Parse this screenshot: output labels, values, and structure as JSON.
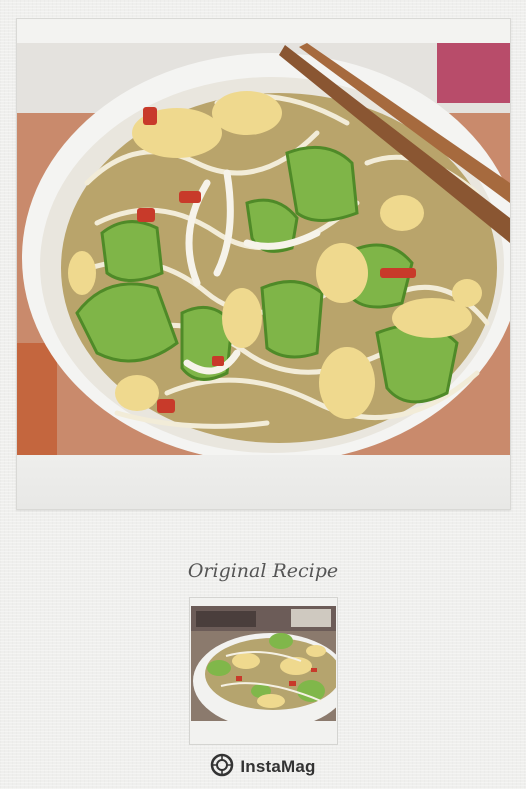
{
  "caption": "Original Recipe",
  "brand": {
    "name": "InstaMag",
    "icon": "instamag-logo-icon"
  },
  "colors": {
    "background": "#efefed",
    "caption_text": "#555555",
    "brand_text": "#333333"
  }
}
